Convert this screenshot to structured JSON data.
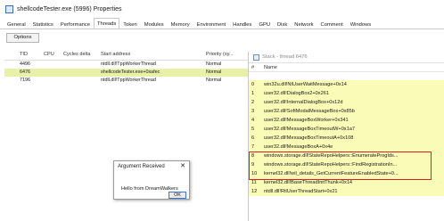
{
  "window": {
    "title": "shellcodeTester.exe (5996) Properties"
  },
  "tabs": [
    "General",
    "Statistics",
    "Performance",
    "Threads",
    "Token",
    "Modules",
    "Memory",
    "Environment",
    "Handles",
    "GPU",
    "Disk",
    "Network",
    "Comment",
    "Windows"
  ],
  "active_tab": "Threads",
  "options_label": "Options",
  "threads": {
    "headers": {
      "tid": "TID",
      "cpu": "CPU",
      "cycles": "Cycles delta",
      "start": "Start address",
      "priority": "Priority (sy..."
    },
    "rows": [
      {
        "tid": "4496",
        "cpu": "",
        "cycles": "",
        "start": "ntdll.dll!TppWorkerThread",
        "priority": "Normal",
        "selected": false
      },
      {
        "tid": "6476",
        "cpu": "",
        "cycles": "",
        "start": "shellcodeTester.exe+0xafec",
        "priority": "Normal",
        "selected": true
      },
      {
        "tid": "7196",
        "cpu": "",
        "cycles": "",
        "start": "ntdll.dll!TppWorkerThread",
        "priority": "Normal",
        "selected": false
      }
    ]
  },
  "stack": {
    "title": "Stack - thread 6476",
    "headers": {
      "num": "#",
      "name": "Name"
    },
    "frames": [
      {
        "num": "0",
        "name": "win32u.dll!NtUserWaitMessage+0x14"
      },
      {
        "num": "1",
        "name": "user32.dll!DialogBox2+0x261"
      },
      {
        "num": "2",
        "name": "user32.dll!InternalDialogBox+0x12d"
      },
      {
        "num": "3",
        "name": "user32.dll!SoftModalMessageBox+0x85b"
      },
      {
        "num": "4",
        "name": "user32.dll!MessageBoxWorker+0x341"
      },
      {
        "num": "5",
        "name": "user32.dll!MessageBoxTimeoutW+0x1a7"
      },
      {
        "num": "6",
        "name": "user32.dll!MessageBoxTimeoutA+0x108"
      },
      {
        "num": "7",
        "name": "user32.dll!MessageBoxA+0x4e"
      },
      {
        "num": "8",
        "name": "windows.storage.dll!StateRepoHelpers::EnumerateProgIds..."
      },
      {
        "num": "9",
        "name": "windows.storage.dll!StateRepoHelpers::FindRegistrationIn..."
      },
      {
        "num": "10",
        "name": "kernel32.dll!wil_details_GetCurrentFeatureEnabledState+0..."
      },
      {
        "num": "11",
        "name": "kernel32.dll!BaseThreadInitThunk+0x14"
      },
      {
        "num": "12",
        "name": "ntdll.dll!RtlUserThreadStart+0x21"
      }
    ]
  },
  "dialog": {
    "title": "Argument Received",
    "close_glyph": "✕",
    "message": "Hello from DreamWalkers",
    "ok_label": "OK"
  },
  "colors": {
    "selected_row": "#e7f1a8",
    "stack_frame": "#fbfbb8",
    "highlight_border": "#e02020"
  }
}
